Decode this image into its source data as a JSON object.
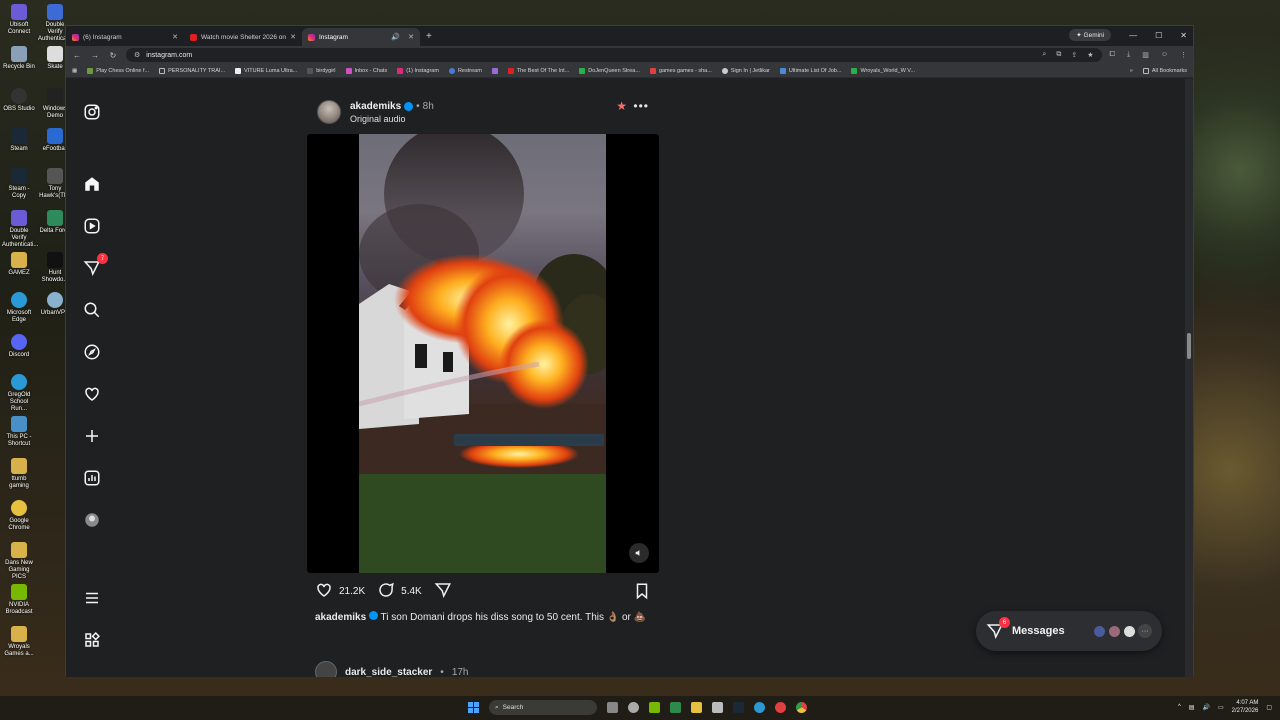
{
  "desktop": {
    "icons": [
      "Ubisoft Connect",
      "Double Verify Authenticat...",
      "Recycle Bin",
      "Skate",
      "OBS Studio",
      "Windows Demo",
      "Steam",
      "eFootball",
      "Steam - Copy",
      "Tony Hawk's(TM)",
      "Double Verify Authenticati...",
      "Delta Force",
      "GAMEZ",
      "Hunt Showdo...",
      "Microsoft Edge",
      "UrbanVPN",
      "Discord",
      "GregOld School Run...",
      "This PC - Shortcut",
      "ttumb gaming",
      "Google Chrome",
      "Dans New Gaming PICS",
      "NVIDIA Broadcast",
      "Wroyals Games a..."
    ]
  },
  "browser": {
    "tabs": [
      {
        "title": "(6) Instagram",
        "active": false
      },
      {
        "title": "Watch movie Shelter 2026 on I...",
        "active": false
      },
      {
        "title": "Instagram",
        "active": true
      }
    ],
    "gemini_label": "Gemini",
    "url": "instagram.com",
    "bookmarks": [
      "Play Chess Online f...",
      "PERSONALITY TRAI...",
      "VITURE Luma Ultra...",
      "birdygirl",
      "Inbox - Chats",
      "(1) Instagram",
      "Restream",
      "The Best Of The Int...",
      "DoJenQueen Strea...",
      "games games - sha...",
      "Sign In | Jetlikar",
      "Ultimate List Of Job...",
      "Wroyals_World_W V..."
    ],
    "all_bookmarks_label": "All Bookmarks"
  },
  "sidebar": {
    "icons": [
      "instagram-logo-icon",
      "home-icon",
      "reels-icon",
      "messenger-icon",
      "search-icon",
      "explore-icon",
      "heart-icon",
      "create-icon",
      "dashboard-icon",
      "profile-icon",
      "menu-icon",
      "more-apps-icon"
    ],
    "notification_badge": "7"
  },
  "post": {
    "username": "akademiks",
    "time": "8h",
    "audio": "Original audio",
    "likes": "21.2K",
    "comments": "5.4K",
    "caption_user": "akademiks",
    "caption_text": "Ti son Domani drops his diss song to 50 cent. This 👌🏽 or 💩"
  },
  "next_post": {
    "username": "dark_side_stacker",
    "time": "17h"
  },
  "messages": {
    "label": "Messages",
    "badge": "6"
  },
  "taskbar": {
    "search_placeholder": "Search",
    "time": "4:07 AM",
    "date": "2/27/2026"
  }
}
